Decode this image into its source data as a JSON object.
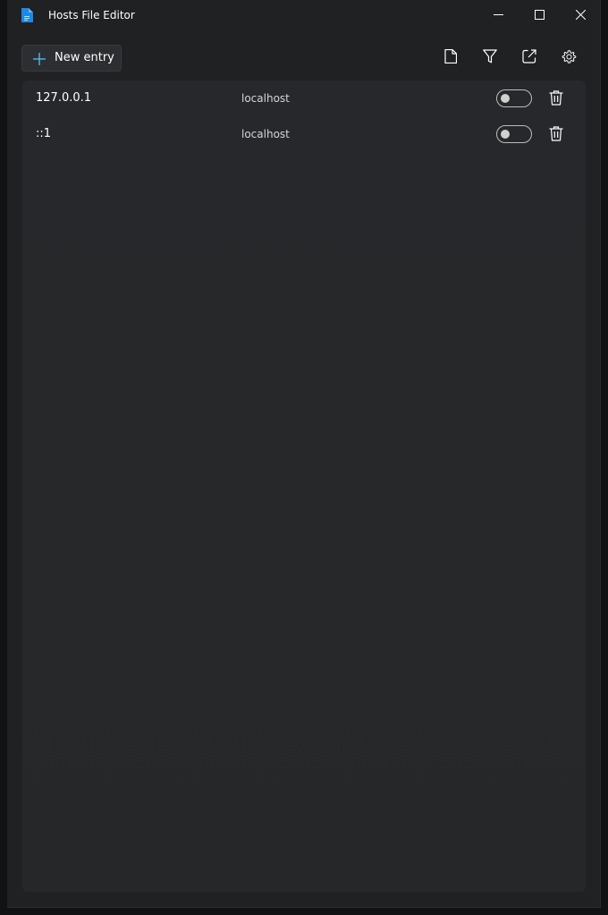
{
  "window": {
    "title": "Hosts File Editor",
    "icon": "document-blue-icon",
    "controls": [
      "minimize-icon",
      "maximize-icon",
      "close-icon"
    ]
  },
  "toolbar": {
    "new_entry_label": "New entry",
    "icons": [
      "file-icon",
      "filter-icon",
      "open-external-icon",
      "gear-icon"
    ]
  },
  "entries": [
    {
      "address": "127.0.0.1",
      "host": "localhost",
      "enabled": false
    },
    {
      "address": "::1",
      "host": "localhost",
      "enabled": false
    }
  ],
  "colors": {
    "accent": "#1e88e5",
    "window_bg": "#202123",
    "panel_bg": "#27282b"
  }
}
